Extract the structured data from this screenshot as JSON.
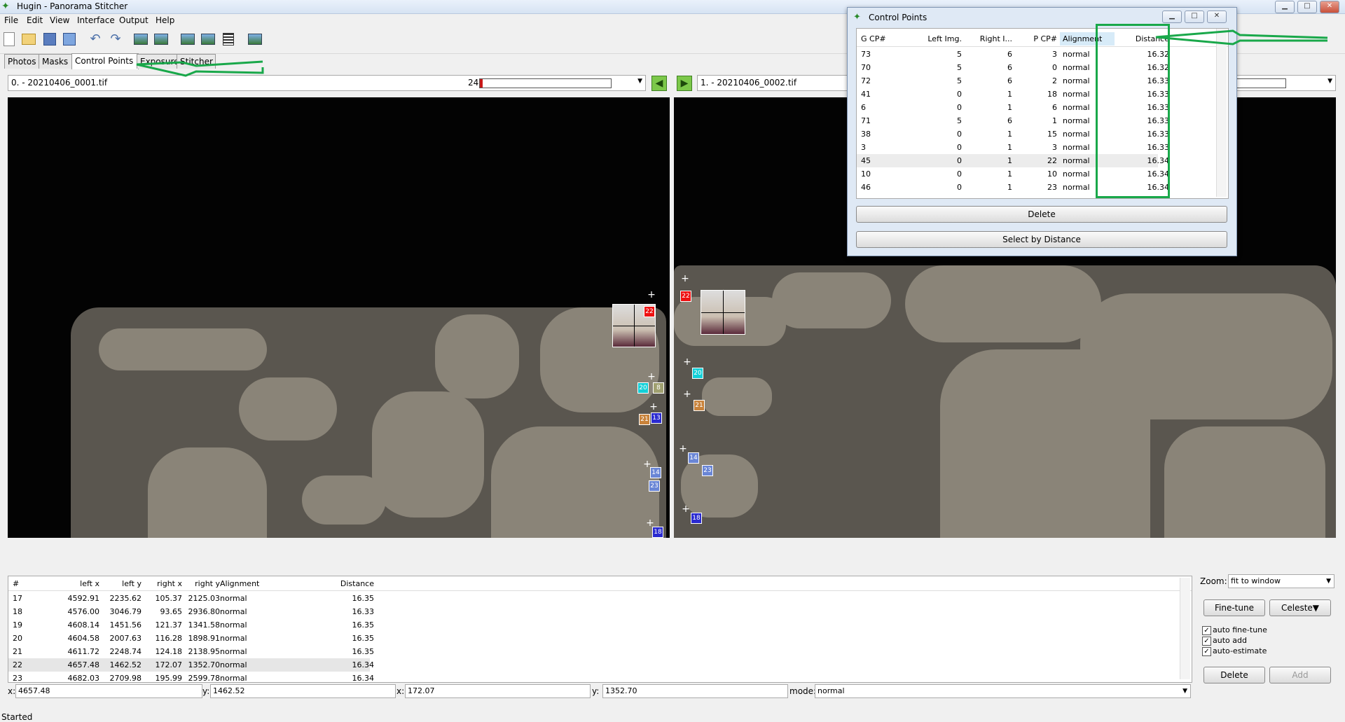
{
  "window": {
    "title": "Hugin - Panorama Stitcher"
  },
  "menu": [
    "File",
    "Edit",
    "View",
    "Interface",
    "Output",
    "Help"
  ],
  "tabs": [
    "Photos",
    "Masks",
    "Control Points",
    "Exposure",
    "Stitcher"
  ],
  "left_image": {
    "name": "0. - 20210406_0001.tif",
    "cp_count": "24",
    "progress": 0.02
  },
  "right_image": {
    "name": "1. - 20210406_0002.tif"
  },
  "cp_table": {
    "headers": [
      "#",
      "left x",
      "left y",
      "right x",
      "right y",
      "Alignment",
      "Distance"
    ],
    "rows": [
      [
        "17",
        "4592.91",
        "2235.62",
        "105.37",
        "2125.03",
        "normal",
        "16.35"
      ],
      [
        "18",
        "4576.00",
        "3046.79",
        "93.65",
        "2936.80",
        "normal",
        "16.33"
      ],
      [
        "19",
        "4608.14",
        "1451.56",
        "121.37",
        "1341.58",
        "normal",
        "16.35"
      ],
      [
        "20",
        "4604.58",
        "2007.63",
        "116.28",
        "1898.91",
        "normal",
        "16.35"
      ],
      [
        "21",
        "4611.72",
        "2248.74",
        "124.18",
        "2138.95",
        "normal",
        "16.35"
      ],
      [
        "22",
        "4657.48",
        "1462.52",
        "172.07",
        "1352.70",
        "normal",
        "16.34"
      ],
      [
        "23",
        "4682.03",
        "2709.98",
        "195.99",
        "2599.78",
        "normal",
        "16.34"
      ]
    ],
    "selected_index": 5
  },
  "coords": {
    "x_label": "x:",
    "x1": "4657.48",
    "y_label": "y:",
    "y1": "1462.52",
    "x2": "172.07",
    "y2": "1352.70",
    "mode_label": "mode:",
    "mode": "normal"
  },
  "right_panel": {
    "zoom_label": "Zoom:",
    "zoom_value": "fit to window",
    "fine_tune": "Fine-tune",
    "celeste": "Celeste▼",
    "checks": [
      {
        "label": "auto fine-tune",
        "checked": true
      },
      {
        "label": "auto add",
        "checked": true
      },
      {
        "label": "auto-estimate",
        "checked": true
      }
    ],
    "delete": "Delete",
    "add": "Add"
  },
  "status": "Started",
  "dialog": {
    "title": "Control Points",
    "headers": [
      "G CP#",
      "Left Img.",
      "Right I...",
      "P CP#",
      "Alignment",
      "Distance"
    ],
    "rows": [
      [
        "73",
        "5",
        "6",
        "3",
        "normal",
        "16.32"
      ],
      [
        "70",
        "5",
        "6",
        "0",
        "normal",
        "16.32"
      ],
      [
        "72",
        "5",
        "6",
        "2",
        "normal",
        "16.33"
      ],
      [
        "41",
        "0",
        "1",
        "18",
        "normal",
        "16.33"
      ],
      [
        "6",
        "0",
        "1",
        "6",
        "normal",
        "16.33"
      ],
      [
        "71",
        "5",
        "6",
        "1",
        "normal",
        "16.33"
      ],
      [
        "38",
        "0",
        "1",
        "15",
        "normal",
        "16.33"
      ],
      [
        "3",
        "0",
        "1",
        "3",
        "normal",
        "16.33"
      ],
      [
        "45",
        "0",
        "1",
        "22",
        "normal",
        "16.34"
      ],
      [
        "10",
        "0",
        "1",
        "10",
        "normal",
        "16.34"
      ],
      [
        "46",
        "0",
        "1",
        "23",
        "normal",
        "16.34"
      ]
    ],
    "selected_index": 8,
    "delete": "Delete",
    "select_by_distance": "Select by Distance"
  },
  "left_cp_labels": [
    "22",
    "20",
    "8",
    "21",
    "13",
    "14",
    "23",
    "18"
  ],
  "right_cp_labels": [
    "22",
    "20",
    "21",
    "14",
    "23",
    "18"
  ],
  "colors": {
    "cp_red": "#e11",
    "cp_cyan": "#13d0d8",
    "cp_orange": "#c8823a",
    "cp_blue": "#2a2ad0",
    "cp_lightblue": "#6a86d6",
    "annotation_green": "#19a84a"
  }
}
